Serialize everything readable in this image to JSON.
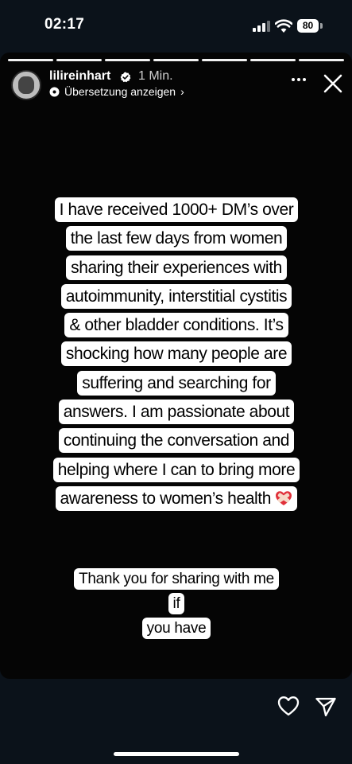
{
  "status": {
    "time": "02:17",
    "battery": "80"
  },
  "story": {
    "username": "lilireinhart",
    "time_ago": "1 Min.",
    "translate": "Übersetzung anzeigen",
    "progress": {
      "segments": 7,
      "completed": 7
    },
    "caption_lines": [
      "I have received 1000+ DM’s over",
      "the last few days from women",
      "sharing their experiences with",
      "autoimmunity, interstitial cystitis",
      "& other bladder conditions. It’s",
      "shocking how many people are",
      "suffering and searching for",
      "answers. I am passionate about",
      "continuing the conversation and",
      "helping where I can to bring more",
      "awareness to women’s health"
    ],
    "caption2_lines": [
      "Thank you for sharing with me if",
      "you have"
    ]
  },
  "icons": {
    "verified": "verified-badge-icon",
    "more": "more-options-icon",
    "close": "close-icon",
    "like": "heart-icon",
    "share": "send-icon",
    "emoji": "heart-with-bandage-emoji"
  }
}
